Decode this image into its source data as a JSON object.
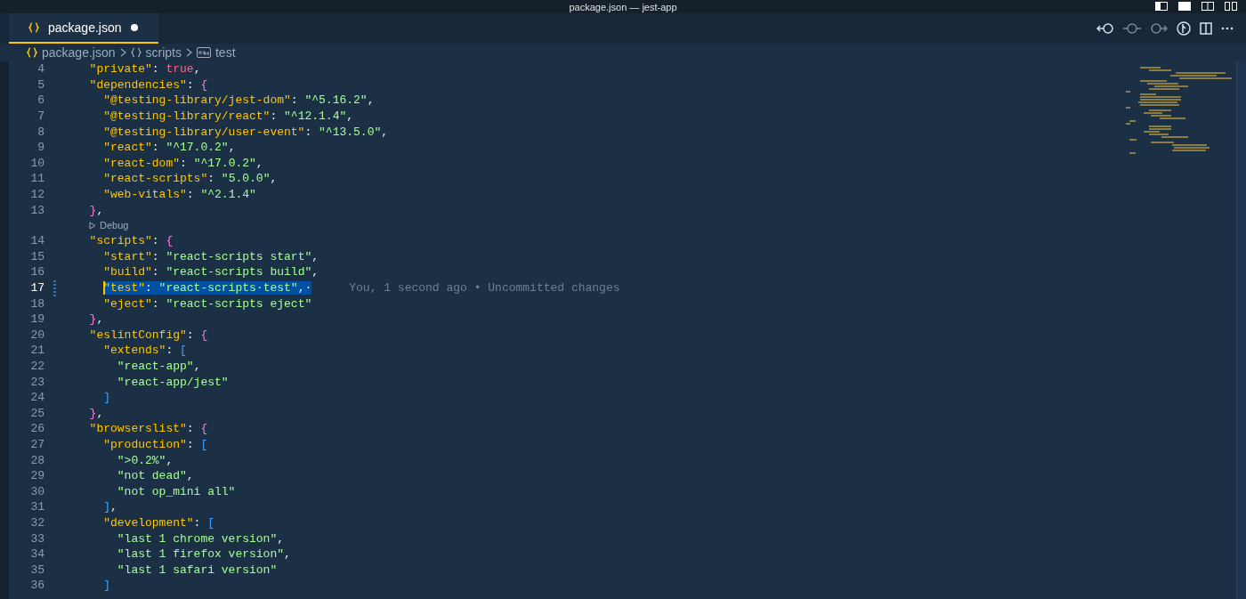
{
  "window": {
    "title": "package.json — jest-app"
  },
  "tabs": [
    {
      "label": "package.json",
      "selected": true,
      "modified": true
    }
  ],
  "breadcrumb": [
    {
      "kind": "json",
      "label": "package.json"
    },
    {
      "kind": "object",
      "label": "scripts"
    },
    {
      "kind": "string",
      "label": "test"
    }
  ],
  "editor": {
    "lines": [
      {
        "number": "4",
        "selected": false,
        "tokens": [
          {
            "kind": "key",
            "text": "  \"private\""
          },
          {
            "kind": "punct",
            "text": ": "
          },
          {
            "kind": "bool",
            "text": "true"
          },
          {
            "kind": "punct",
            "text": ","
          }
        ]
      },
      {
        "number": "5",
        "selected": false,
        "tokens": [
          {
            "kind": "key",
            "text": "  \"dependencies\""
          },
          {
            "kind": "punct",
            "text": ": "
          },
          {
            "kind": "brace",
            "text": "{"
          }
        ]
      },
      {
        "number": "6",
        "selected": false,
        "tokens": [
          {
            "kind": "key",
            "text": "    \"@testing-library/jest-dom\""
          },
          {
            "kind": "punct",
            "text": ": "
          },
          {
            "kind": "string",
            "text": "\"^5.16.2\""
          },
          {
            "kind": "punct",
            "text": ","
          }
        ]
      },
      {
        "number": "7",
        "selected": false,
        "tokens": [
          {
            "kind": "key",
            "text": "    \"@testing-library/react\""
          },
          {
            "kind": "punct",
            "text": ": "
          },
          {
            "kind": "string",
            "text": "\"^12.1.4\""
          },
          {
            "kind": "punct",
            "text": ","
          }
        ]
      },
      {
        "number": "8",
        "selected": false,
        "tokens": [
          {
            "kind": "key",
            "text": "    \"@testing-library/user-event\""
          },
          {
            "kind": "punct",
            "text": ": "
          },
          {
            "kind": "string",
            "text": "\"^13.5.0\""
          },
          {
            "kind": "punct",
            "text": ","
          }
        ]
      },
      {
        "number": "9",
        "selected": false,
        "tokens": [
          {
            "kind": "key",
            "text": "    \"react\""
          },
          {
            "kind": "punct",
            "text": ": "
          },
          {
            "kind": "string",
            "text": "\"^17.0.2\""
          },
          {
            "kind": "punct",
            "text": ","
          }
        ]
      },
      {
        "number": "10",
        "selected": false,
        "tokens": [
          {
            "kind": "key",
            "text": "    \"react-dom\""
          },
          {
            "kind": "punct",
            "text": ": "
          },
          {
            "kind": "string",
            "text": "\"^17.0.2\""
          },
          {
            "kind": "punct",
            "text": ","
          }
        ]
      },
      {
        "number": "11",
        "selected": false,
        "tokens": [
          {
            "kind": "key",
            "text": "    \"react-scripts\""
          },
          {
            "kind": "punct",
            "text": ": "
          },
          {
            "kind": "string",
            "text": "\"5.0.0\""
          },
          {
            "kind": "punct",
            "text": ","
          }
        ]
      },
      {
        "number": "12",
        "selected": false,
        "tokens": [
          {
            "kind": "key",
            "text": "    \"web-vitals\""
          },
          {
            "kind": "punct",
            "text": ": "
          },
          {
            "kind": "string",
            "text": "\"^2.1.4\""
          }
        ]
      },
      {
        "number": "13",
        "selected": false,
        "tokens": [
          {
            "kind": "brace",
            "text": "  }"
          },
          {
            "kind": "punct",
            "text": ","
          }
        ],
        "codelens": "Debug"
      },
      {
        "number": "14",
        "selected": false,
        "tokens": [
          {
            "kind": "key",
            "text": "  \"scripts\""
          },
          {
            "kind": "punct",
            "text": ": "
          },
          {
            "kind": "brace",
            "text": "{"
          }
        ]
      },
      {
        "number": "15",
        "selected": false,
        "tokens": [
          {
            "kind": "key",
            "text": "    \"start\""
          },
          {
            "kind": "punct",
            "text": ": "
          },
          {
            "kind": "string",
            "text": "\"react-scripts start\""
          },
          {
            "kind": "punct",
            "text": ","
          }
        ]
      },
      {
        "number": "16",
        "selected": false,
        "tokens": [
          {
            "kind": "key",
            "text": "    \"build\""
          },
          {
            "kind": "punct",
            "text": ": "
          },
          {
            "kind": "string",
            "text": "\"react-scripts build\""
          },
          {
            "kind": "punct",
            "text": ","
          }
        ]
      },
      {
        "number": "17",
        "selected": true,
        "tokens": [
          {
            "kind": "key",
            "text": "    \"test\""
          },
          {
            "kind": "punct",
            "text": ": "
          },
          {
            "kind": "string",
            "text": "\"react-scripts·test\""
          },
          {
            "kind": "punct",
            "text": ",·"
          }
        ],
        "blame": "You, 1 second ago • Uncommitted changes"
      },
      {
        "number": "18",
        "selected": false,
        "tokens": [
          {
            "kind": "key",
            "text": "    \"eject\""
          },
          {
            "kind": "punct",
            "text": ": "
          },
          {
            "kind": "string",
            "text": "\"react-scripts eject\""
          }
        ]
      },
      {
        "number": "19",
        "selected": false,
        "tokens": [
          {
            "kind": "brace",
            "text": "  }"
          },
          {
            "kind": "punct",
            "text": ","
          }
        ]
      },
      {
        "number": "20",
        "selected": false,
        "tokens": [
          {
            "kind": "key",
            "text": "  \"eslintConfig\""
          },
          {
            "kind": "punct",
            "text": ": "
          },
          {
            "kind": "brace",
            "text": "{"
          }
        ]
      },
      {
        "number": "21",
        "selected": false,
        "tokens": [
          {
            "kind": "key",
            "text": "    \"extends\""
          },
          {
            "kind": "punct",
            "text": ": "
          },
          {
            "kind": "bracket",
            "text": "["
          }
        ]
      },
      {
        "number": "22",
        "selected": false,
        "tokens": [
          {
            "kind": "string",
            "text": "      \"react-app\""
          },
          {
            "kind": "punct",
            "text": ","
          }
        ]
      },
      {
        "number": "23",
        "selected": false,
        "tokens": [
          {
            "kind": "string",
            "text": "      \"react-app/jest\""
          }
        ]
      },
      {
        "number": "24",
        "selected": false,
        "tokens": [
          {
            "kind": "bracket",
            "text": "    ]"
          }
        ]
      },
      {
        "number": "25",
        "selected": false,
        "tokens": [
          {
            "kind": "brace",
            "text": "  }"
          },
          {
            "kind": "punct",
            "text": ","
          }
        ]
      },
      {
        "number": "26",
        "selected": false,
        "tokens": [
          {
            "kind": "key",
            "text": "  \"browserslist\""
          },
          {
            "kind": "punct",
            "text": ": "
          },
          {
            "kind": "brace",
            "text": "{"
          }
        ]
      },
      {
        "number": "27",
        "selected": false,
        "tokens": [
          {
            "kind": "key",
            "text": "    \"production\""
          },
          {
            "kind": "punct",
            "text": ": "
          },
          {
            "kind": "bracket",
            "text": "["
          }
        ]
      },
      {
        "number": "28",
        "selected": false,
        "tokens": [
          {
            "kind": "string",
            "text": "      \">0.2%\""
          },
          {
            "kind": "punct",
            "text": ","
          }
        ]
      },
      {
        "number": "29",
        "selected": false,
        "tokens": [
          {
            "kind": "string",
            "text": "      \"not dead\""
          },
          {
            "kind": "punct",
            "text": ","
          }
        ]
      },
      {
        "number": "30",
        "selected": false,
        "tokens": [
          {
            "kind": "string",
            "text": "      \"not op_mini all\""
          }
        ]
      },
      {
        "number": "31",
        "selected": false,
        "tokens": [
          {
            "kind": "bracket",
            "text": "    ]"
          },
          {
            "kind": "punct",
            "text": ","
          }
        ]
      },
      {
        "number": "32",
        "selected": false,
        "tokens": [
          {
            "kind": "key",
            "text": "    \"development\""
          },
          {
            "kind": "punct",
            "text": ": "
          },
          {
            "kind": "bracket",
            "text": "["
          }
        ]
      },
      {
        "number": "33",
        "selected": false,
        "tokens": [
          {
            "kind": "string",
            "text": "      \"last 1 chrome version\""
          },
          {
            "kind": "punct",
            "text": ","
          }
        ]
      },
      {
        "number": "34",
        "selected": false,
        "tokens": [
          {
            "kind": "string",
            "text": "      \"last 1 firefox version\""
          },
          {
            "kind": "punct",
            "text": ","
          }
        ]
      },
      {
        "number": "35",
        "selected": false,
        "tokens": [
          {
            "kind": "string",
            "text": "      \"last 1 safari version\""
          }
        ]
      },
      {
        "number": "36",
        "selected": false,
        "tokens": [
          {
            "kind": "bracket",
            "text": "    ]"
          }
        ]
      }
    ]
  }
}
